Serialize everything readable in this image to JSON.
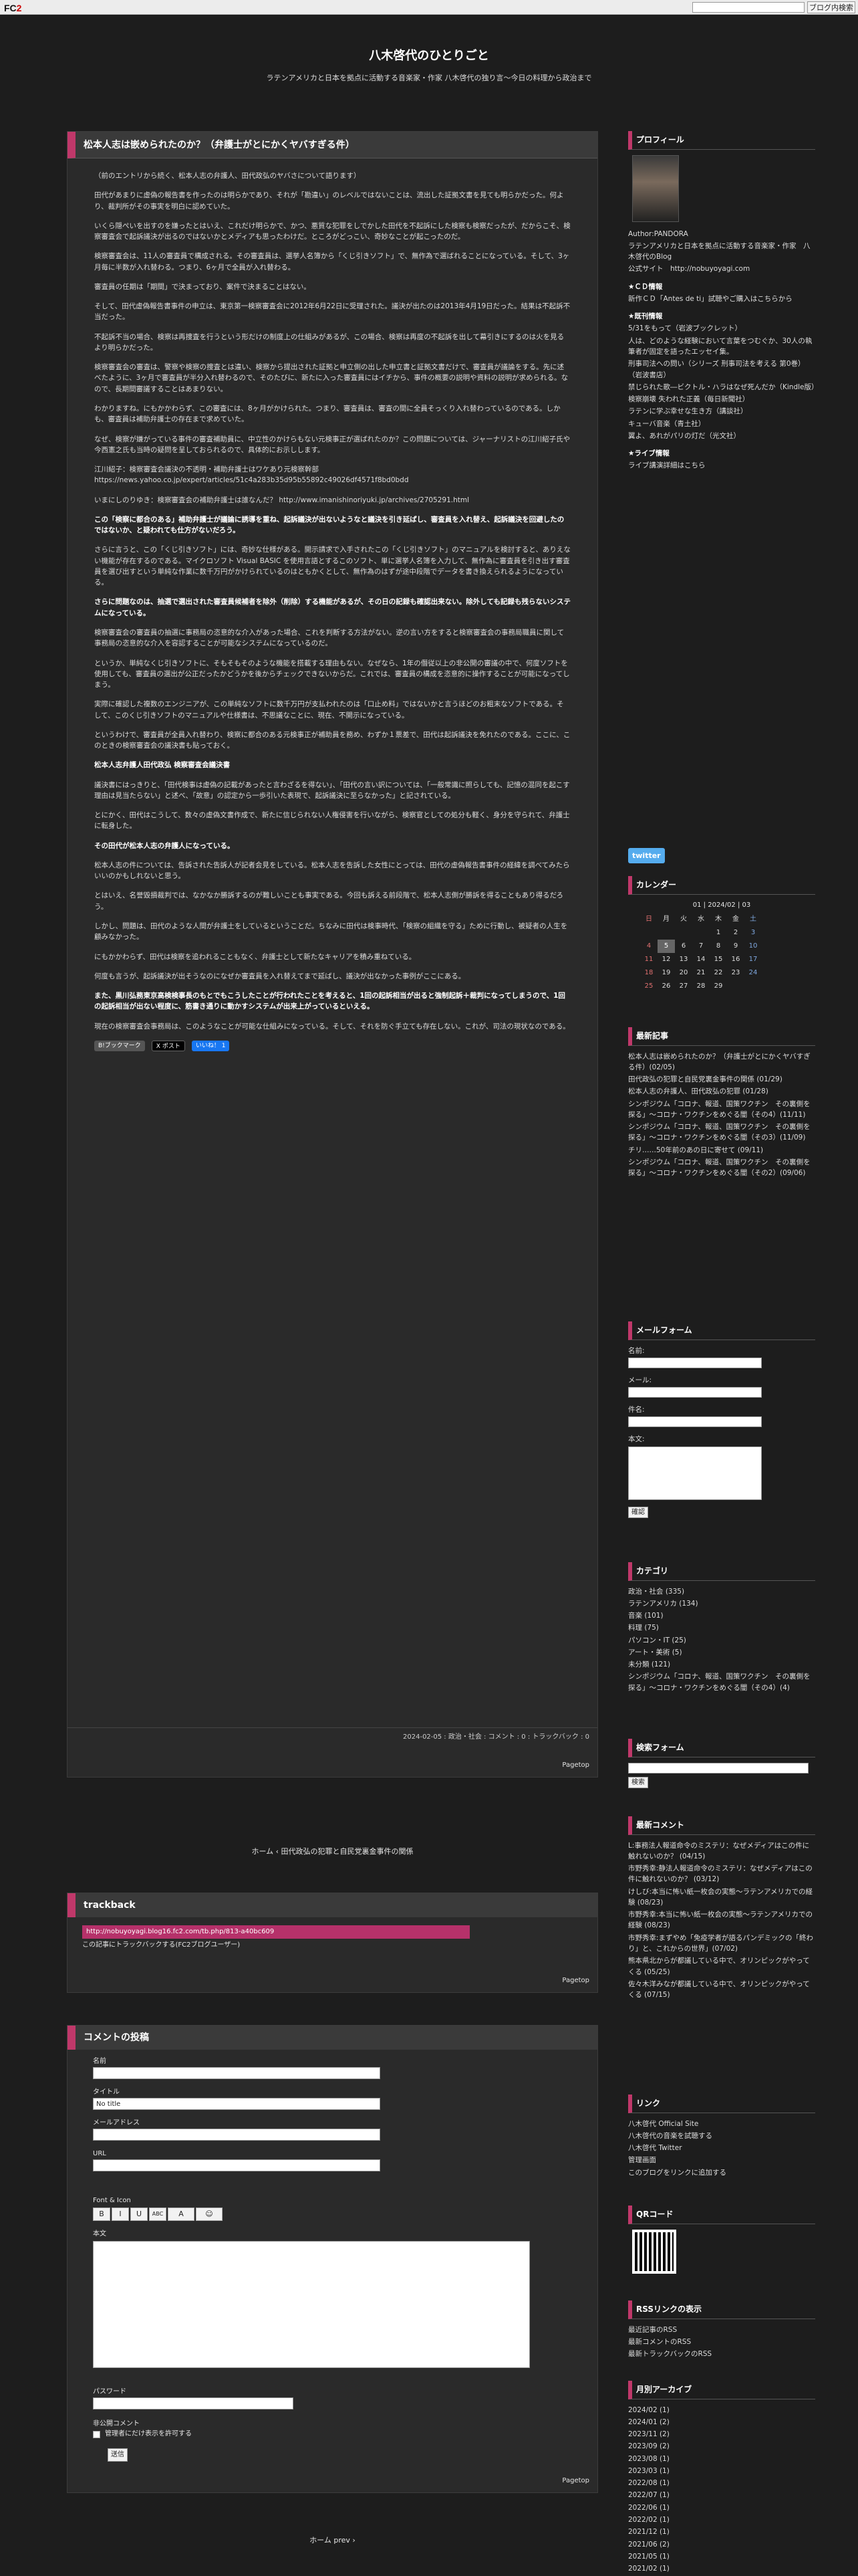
{
  "topbar": {
    "logo_prefix": "FC",
    "logo_suffix": "2",
    "button": "ブログ内検索"
  },
  "header": {
    "title": "八木啓代のひとりごと",
    "subtitle": "ラテンアメリカと日本を拠点に活動する音楽家・作家 八木啓代の独り言〜今日の料理から政治まで"
  },
  "entry": {
    "title": "松本人志は嵌められたのか？（弁護士がとにかくヤバすぎる件）",
    "paragraphs": [
      {
        "t": "（前のエントリから続く、松本人志の弁護人、田代政弘のヤバさについて語ります）",
        "s": ""
      },
      {
        "t": "田代があまりに虚偽の報告書を作ったのは明らかであり、それが「勘違い」のレベルではないことは、流出した証拠文書を見ても明らかだった。何より、裁判所がその事実を明白に認めていた。",
        "s": ""
      },
      {
        "t": "いくら隠ぺいを出すのを嫌ったとはいえ、これだけ明らかで、かつ、悪質な犯罪をしでかした田代を不起訴にした検察も検察だったが、だからこそ、検察審査会で起訴議決が出るのではないかとメディアも思ったわけだ。ところがどっこい、奇妙なことが起こったのだ。",
        "s": ""
      },
      {
        "t": "検察審査会は、11人の審査員で構成される。その審査員は、選挙人名簿から「くじ引きソフト」で、無作為で選ばれることになっている。そして、3ヶ月毎に半数が入れ替わる。つまり、6ヶ月で全員が入れ替わる。",
        "s": ""
      },
      {
        "t": "審査員の任期は「期間」で決まっており、案件で決まることはない。",
        "s": ""
      },
      {
        "t": "そして、田代虚偽報告書事件の申立は、東京第一検察審査会に2012年6月22日に受理された。議決が出たのは2013年4月19日だった。結果は不起訴不当だった。",
        "s": ""
      },
      {
        "t": "不起訴不当の場合、検察は再捜査を行うという形だけの制度上の仕組みがあるが、この場合、検察は再度の不起訴を出して幕引きにするのは火を見るより明らかだった。",
        "s": ""
      },
      {
        "t": "検察審査会の審査は、警察や検察の捜査とは違い、検察から提出された証拠と申立側の出した申立書と証拠文書だけで、審査員が議論をする。先に述べたように、3ヶ月で審査員が半分入れ替わるので、そのたびに、新たに入った審査員にはイチから、事件の概要の説明や資料の説明が求められる。なので、長期間審議することはあまりない。",
        "s": ""
      },
      {
        "t": "わかりますね。にもかかわらず、この審査には、8ヶ月がかけられた。つまり、審査員は、審査の間に全員そっくり入れ替わっているのである。しかも、審査員は補助弁護士の存在まで求めていた。",
        "s": ""
      },
      {
        "t": "なぜ、検察が嫌がっている事件の審査補助員に、中立性のかけらもない元検事正が選ばれたのか？この問題については、ジャーナリストの江川紹子氏や今西憲之氏も当時の疑問を呈しておられるので、具体的にお示しします。",
        "s": ""
      },
      {
        "t": "江川紹子：検察審査会議決の不透明・補助弁護士はワケあり元検察幹部 https://news.yahoo.co.jp/expert/articles/51c4a283b35d95b55892c49026df4571f8bd0bdd",
        "s": ""
      },
      {
        "t": "いまにしのりゆき：検察審査会の補助弁護士は誰なんだ？ http://www.imanishinoriyuki.jp/archives/2705291.html",
        "s": ""
      },
      {
        "t": "この「検察に都合のある」補助弁護士が議論に誘導を重ね、起訴議決が出ないようなと議決を引き延ばし、審査員を入れ替え、起訴議決を回避したのではないか、と疑われても仕方がないだろう。",
        "s": "bold"
      },
      {
        "t": "さらに言うと、この「くじ引きソフト」には、奇妙な仕様がある。開示請求で入手されたこの「くじ引きソフト」のマニュアルを検討すると、ありえない機能が存在するのである。マイクロソフト Visual BASIC を使用言語とするこのソフト、単に選挙人名簿を入力して、無作為に審査員を引き出す審査員を選び出すという単純な作業に数千万円がかけられているのはともかくとして、無作為のはずが途中段階でデータを書き換えられるようになっている。",
        "s": ""
      },
      {
        "t": "さらに問題なのは、抽選で選出された審査員候補者を除外（削除）する機能があるが、その日の記録も確認出来ない。除外しても記録も残らないシステムになっている。",
        "s": "bold"
      },
      {
        "t": "検察審査会の審査員の抽選に事務局の恣意的な介入があった場合、これを判断する方法がない。逆の言い方をすると検察審査会の事務局職員に関して事務局の恣意的な介入を容認することが可能なシステムになっているのだ。",
        "s": ""
      },
      {
        "t": "というか、単純なくじ引きソフトに、そもそもそのような機能を搭載する理由もない。なぜなら、1年の僭従以上の非公開の審議の中で、何度ソフトを使用しても、審査員の選出が公正だったかどうかを後からチェックできないからだ。これでは、審査員の構成を恣意的に操作することが可能になってしまう。",
        "s": ""
      },
      {
        "t": "実際に確認した複数のエンジニアが、この単純なソフトに数千万円が支払われたのは「口止め料」ではないかと言うほどのお粗末なソフトである。そして、このくじ引きソフトのマニュアルや仕様書は、不思議なことに、現在、不開示になっている。",
        "s": ""
      },
      {
        "t": "というわけで、審査員が全員入れ替わり、検察に都合のある元検事正が補助員を務め、わずか１票差で、田代は起訴議決を免れたのである。ここに、このときの検察審査会の議決書も貼っておく。",
        "s": ""
      },
      {
        "t": "松本人志弁護人田代政弘 検察審査会議決書",
        "s": "hi"
      },
      {
        "t": "議決書にはっきりと、「田代検事は虚偽の記載があったと言わざるを得ない」、「田代の言い訳については、「一般常識に照らしても、記憶の混同を起こす理由は見当たらない」と述べ、「故意」の認定から一歩引いた表現で、起訴議決に至らなかった」と記されている。",
        "s": ""
      },
      {
        "t": "とにかく、田代はこうして、数々の虚偽文書作成で、新たに信じられない人権侵害を行いながら、検察官としての処分も軽く、身分を守られて、弁護士に転身した。",
        "s": ""
      },
      {
        "t": "その田代が松本人志の弁護人になっている。",
        "s": "hi"
      },
      {
        "t": "松本人志の件については、告訴された告訴人が記者会見をしている。松本人志を告訴した女性にとっては、田代の虚偽報告書事件の経緯を調べてみたらいいのかもしれないと思う。",
        "s": ""
      },
      {
        "t": "とはいえ、名誉毀損裁判では、なかなか勝訴するのが難しいことも事実である。今回も訴える前段階で、松本人志側が勝訴を得ることもあり得るだろう。",
        "s": ""
      },
      {
        "t": "しかし、問題は、田代のような人間が弁護士をしているということだ。ちなみに田代は検事時代、「検察の組織を守る」ために行動し、被疑者の人生を顧みなかった。",
        "s": ""
      },
      {
        "t": "にもかかわらず、田代は検察を追われることもなく、弁護士として新たなキャリアを積み重ねている。",
        "s": ""
      },
      {
        "t": "何度も言うが、起訴議決が出そうなのになぜか審査員を入れ替えてまで延ばし、議決が出なかった事例がここにある。",
        "s": ""
      },
      {
        "t": "また、黒川弘務東京高検検事長のもとでもこうしたことが行われたことを考えると、1回の起訴相当が出ると強制起訴＋裁判になってしまうので、1回の起訴相当が出ない程度に、筋書き通りに動かすシステムが出来上がっているといえる。",
        "s": "bold"
      },
      {
        "t": "現在の検察審査会事務局は、このようなことが可能な仕組みになっている。そして、それを防ぐ手立ても存在しない。これが、司法の現状なのである。",
        "s": ""
      }
    ],
    "social": {
      "hatena": "B!ブックマーク",
      "x": "X ポスト",
      "fb": "いいね！ 1"
    },
    "meta": "2024-02-05 : 政治・社会 : コメント : 0 : トラックバック : 0",
    "pagetop": "Pagetop"
  },
  "nav": {
    "text": "ホーム ‹ 田代政弘の犯罪と自民党裏金事件の関係"
  },
  "trackback": {
    "title": "trackback",
    "url": "http://nobuyoyagi.blog16.fc2.com/tb.php/813-a40bc609",
    "link": "この記事にトラックバックする(FC2ブログユーザー)",
    "pagetop": "Pagetop"
  },
  "comment": {
    "title": "コメントの投稿",
    "name_label": "名前",
    "title_label": "タイトル",
    "title_value": "No title",
    "mail_label": "メールアドレス",
    "url_label": "URL",
    "font_label": "Font & Icon",
    "body_label": "本文",
    "pass_label": "パスワード",
    "secret_label": "非公開コメント",
    "secret_text": "管理者にだけ表示を許可する",
    "send": "送信",
    "pagetop": "Pagetop",
    "toolbar": [
      "B",
      "I",
      "U",
      "ABC",
      "A",
      "☺"
    ]
  },
  "bottom": {
    "text": "ホーム  prev ›"
  },
  "sidebar": {
    "profile_title": "プロフィール",
    "profile_lines": [
      "Author:PANDORA",
      "ラテンアメリカと日本を拠点に活動する音楽家・作家　八木啓代のBlog",
      "公式サイト　http://nobuyoyagi.com"
    ],
    "cd_head": "★ＣＤ情報",
    "cd_lines": [
      "新作ＣＤ「Antes de ti」試聴やご購入はこちらから"
    ],
    "book_head": "★既刊情報",
    "book_lines": [
      "5/31をもって（岩波ブックレット）",
      "人は、どのような経験において言葉をつむぐか、30人の執筆者が固定を語ったエッセイ集。",
      "刑事司法への問い（シリーズ 刑事司法を考える 第0巻）（岩波書店）",
      "禁じられた歌―ビクトル・ハラはなぜ死んだか（Kindle版）",
      "検察崩壊 失われた正義（毎日新聞社）",
      "ラテンに学ぶ幸せな生き方（講談社）",
      "キューバ音楽（青土社）",
      "翼よ、あれがパリの灯だ（光文社）"
    ],
    "live_head": "★ライブ情報",
    "live_lines": [
      "ライブ講演詳細はこちら"
    ],
    "twitter": "twitter",
    "calendar_title": "カレンダー",
    "calendar_month": "01 | 2024/02 | 03",
    "calendar_headers": [
      "日",
      "月",
      "火",
      "水",
      "木",
      "金",
      "土"
    ],
    "calendar_rows": [
      [
        "",
        "",
        "",
        "",
        "1",
        "2",
        "3"
      ],
      [
        "4",
        "5",
        "6",
        "7",
        "8",
        "9",
        "10"
      ],
      [
        "11",
        "12",
        "13",
        "14",
        "15",
        "16",
        "17"
      ],
      [
        "18",
        "19",
        "20",
        "21",
        "22",
        "23",
        "24"
      ],
      [
        "25",
        "26",
        "27",
        "28",
        "29",
        "",
        ""
      ]
    ],
    "recent_title": "最新記事",
    "recent": [
      "松本人志は嵌められたのか？（弁護士がとにかくヤバすぎる件）(02/05)",
      "田代政弘の犯罪と自民党裏金事件の関係 (01/29)",
      "松本人志の弁護人、田代政弘の犯罪 (01/28)",
      "シンポジウム「コロナ、報道、国策ワクチン　その裏側を探る」〜コロナ・ワクチンをめぐる闇（その4）(11/11)",
      "シンポジウム「コロナ、報道、国策ワクチン　その裏側を探る」〜コロナ・ワクチンをめぐる闇（その3）(11/09)",
      "チリ……50年前のあの日に寄せて (09/11)",
      "シンポジウム「コロナ、報道、国策ワクチン　その裏側を探る」〜コロナ・ワクチンをめぐる闇（その2）(09/06)"
    ],
    "mailform_title": "メールフォーム",
    "mail_labels": [
      "名前:",
      "メール:",
      "件名:",
      "本文:"
    ],
    "mail_btn": "確認",
    "category_title": "カテゴリ",
    "categories": [
      "政治・社会 (335)",
      "ラテンアメリカ (134)",
      "音楽 (101)",
      "料理 (75)",
      "パソコン・IT (25)",
      "アート・美術 (5)",
      "未分類 (121)",
      "シンポジウム「コロナ、報道、国策ワクチン　その裏側を探る」〜コロナ・ワクチンをめぐる闇（その4）(4)"
    ],
    "search_title": "検索フォーム",
    "search_btn": "検索",
    "comments_title": "最新コメント",
    "comments": [
      "L:事務法人報道命令のミステリ：なぜメディアはこの件に触れないのか？ (04/15)",
      "市野秀幸:静法人報道命令のミステリ：なぜメディアはこの件に触れないのか？ (03/12)",
      "けしび:本当に怖い紙一枚会の実態〜ラテンアメリカでの経験 (08/23)",
      "市野秀幸:本当に怖い紙一枚会の実態〜ラテンアメリカでの経験 (08/23)",
      "市野秀幸:まずやめ「免疫学者が語るパンデミックの「終わり」と、これからの世界」(07/02)",
      "熊本県北からが都議している中で、オリンピックがやってくる (05/25)",
      "佐々木洋みなが都議している中で、オリンピックがやってくる (07/15)"
    ],
    "links_title": "リンク",
    "links": [
      "八木啓代 Official Site",
      "八木啓代の音楽を試聴する",
      "八木啓代 Twitter",
      "管理画面",
      "このブログをリンクに追加する"
    ],
    "qr_title": "QRコード",
    "rss_title": "RSSリンクの表示",
    "rss": [
      "最近記事のRSS",
      "最新コメントのRSS",
      "最新トラックバックのRSS"
    ],
    "archive_title": "月別アーカイブ",
    "archives": [
      "2024/02 (1)",
      "2024/01 (2)",
      "2023/11 (2)",
      "2023/09 (2)",
      "2023/08 (1)",
      "2023/03 (1)",
      "2022/08 (1)",
      "2022/07 (1)",
      "2022/06 (1)",
      "2022/02 (1)",
      "2021/12 (1)",
      "2021/06 (2)",
      "2021/05 (1)",
      "2021/02 (1)"
    ]
  }
}
